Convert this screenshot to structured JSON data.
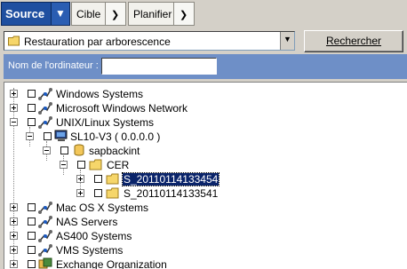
{
  "tabs": [
    {
      "label": "Source",
      "active": true
    },
    {
      "label": "Cible",
      "active": false
    },
    {
      "label": "Planifier",
      "active": false
    }
  ],
  "view_selector": {
    "value": "Restauration par arborescence"
  },
  "search_button": {
    "label": "Rechercher",
    "accelerator": "R"
  },
  "computer_name": {
    "label": "Nom de l'ordinateur :",
    "value": ""
  },
  "tree": [
    {
      "label": "Windows Systems",
      "icon": "network-icon"
    },
    {
      "label": "Microsoft Windows Network",
      "icon": "network-icon"
    },
    {
      "label": "UNIX/Linux Systems",
      "icon": "network-icon"
    },
    {
      "label": "SL10-V3 ( 0.0.0.0 )",
      "icon": "computer-icon"
    },
    {
      "label": "sapbackint",
      "icon": "database-icon"
    },
    {
      "label": "CER",
      "icon": "folder-icon"
    },
    {
      "label": "S_20110114133454",
      "icon": "folder-icon",
      "selected": true
    },
    {
      "label": "S_20110114133541",
      "icon": "folder-icon"
    },
    {
      "label": "Mac OS X Systems",
      "icon": "network-icon"
    },
    {
      "label": "NAS Servers",
      "icon": "network-icon"
    },
    {
      "label": "AS400 Systems",
      "icon": "network-icon"
    },
    {
      "label": "VMS Systems",
      "icon": "network-icon"
    },
    {
      "label": "Exchange Organization",
      "icon": "exchange-icon"
    }
  ],
  "colors": {
    "active_tab": "#1f4fa0",
    "name_bar": "#6e8fc7",
    "selection": "#0a246a",
    "window_bg": "#d4d0c8"
  }
}
